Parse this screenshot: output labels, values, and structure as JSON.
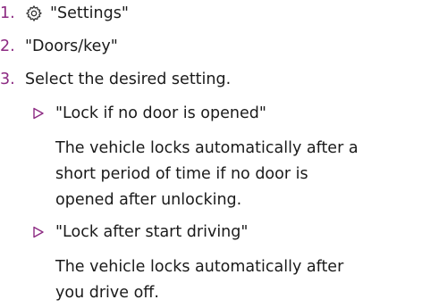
{
  "steps": [
    {
      "number": "1.",
      "icon": "gear-icon",
      "text": "\"Settings\""
    },
    {
      "number": "2.",
      "text": "\"Doors/key\""
    },
    {
      "number": "3.",
      "text": "Select the desired setting."
    }
  ],
  "options": [
    {
      "label": "\"Lock if no door is opened\"",
      "description_lines": [
        "The vehicle locks automatically after a",
        "short period of time if no door is",
        "opened after unlocking."
      ]
    },
    {
      "label": "\"Lock after start driving\"",
      "description_lines": [
        "The vehicle locks automatically after",
        "you drive off."
      ]
    }
  ],
  "colors": {
    "step_number": "#8c2a82",
    "bullet_triangle": "#8c2a82",
    "text": "#1a1a1a"
  }
}
